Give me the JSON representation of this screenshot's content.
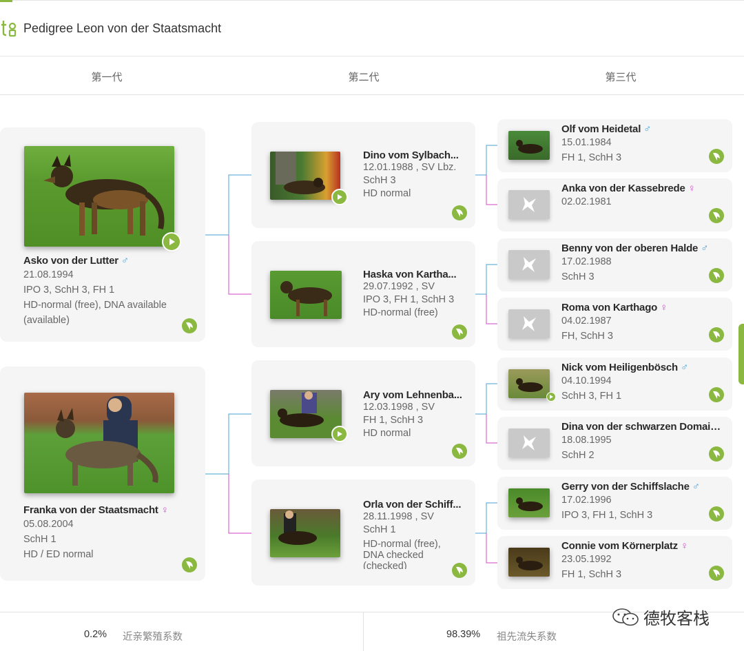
{
  "header": {
    "title": "Pedigree Leon von der Staatsmacht",
    "logo_icon": "tg-logo-icon"
  },
  "generations": [
    "第一代",
    "第二代",
    "第三代"
  ],
  "colors": {
    "accent": "#8ab840",
    "male": "#4a9fd8",
    "female": "#d44ad0",
    "sire_line": "#6bb3d9",
    "dam_line": "#d96bd0"
  },
  "gen1": [
    {
      "name": "Asko von der Lutter",
      "gender": "♂",
      "lines": [
        "21.08.1994",
        "IPO 3, SchH 3, FH 1",
        "HD-normal (free), DNA available",
        "(available)"
      ],
      "has_video": true
    },
    {
      "name": "Franka von der Staatsmacht",
      "gender": "♀",
      "lines": [
        "05.08.2004",
        "SchH 1",
        "HD / ED normal"
      ],
      "has_video": false
    }
  ],
  "gen2": [
    {
      "name": "Dino vom Sylbach...",
      "lines": [
        "12.01.1988 , SV Lbz.",
        "SchH 3",
        "HD normal"
      ],
      "has_video": true
    },
    {
      "name": "Haska von Kartha...",
      "lines": [
        "29.07.1992 , SV",
        "IPO 3, FH 1, SchH 3",
        "HD-normal (free)"
      ],
      "has_video": false
    },
    {
      "name": "Ary vom Lehnenba...",
      "lines": [
        "12.03.1998 , SV",
        "FH 1, SchH 3",
        "HD normal"
      ],
      "has_video": true
    },
    {
      "name": "Orla von der Schiff...",
      "lines": [
        "28.11.1998 , SV",
        "SchH 1",
        "HD-normal (free),",
        "DNA checked",
        "(checked)"
      ],
      "has_video": false
    }
  ],
  "gen3": [
    {
      "name": "Olf vom Heidetal",
      "gender": "♂",
      "lines": [
        "15.01.1984",
        "FH 1, SchH 3"
      ],
      "photo": true
    },
    {
      "name": "Anka von der Kassebrede",
      "gender": "♀",
      "lines": [
        "02.02.1981"
      ],
      "photo": false
    },
    {
      "name": "Benny von der oberen Halde",
      "gender": "♂",
      "lines": [
        "17.02.1988",
        "SchH 3"
      ],
      "photo": false
    },
    {
      "name": "Roma von Karthago",
      "gender": "♀",
      "lines": [
        "04.02.1987",
        "FH, SchH 3"
      ],
      "photo": false
    },
    {
      "name": "Nick vom Heiligenbösch",
      "gender": "♂",
      "lines": [
        "04.10.1994",
        "SchH 3, FH 1"
      ],
      "photo": true
    },
    {
      "name": "Dina von der schwarzen Domain...",
      "gender": "",
      "lines": [
        "18.08.1995",
        "SchH 2"
      ],
      "photo": false
    },
    {
      "name": "Gerry von der Schiffslache",
      "gender": "♂",
      "lines": [
        "17.02.1996",
        "IPO 3, FH 1, SchH 3"
      ],
      "photo": true
    },
    {
      "name": "Connie vom Körnerplatz",
      "gender": "♀",
      "lines": [
        "23.05.1992",
        "FH 1, SchH 3"
      ],
      "photo": true
    }
  ],
  "footer": {
    "inbreeding_value": "0.2%",
    "inbreeding_label": "近亲繁殖系数",
    "ancestor_loss_value": "98.39%",
    "ancestor_loss_label": "祖先流失系数"
  },
  "watermark": "德牧客栈"
}
